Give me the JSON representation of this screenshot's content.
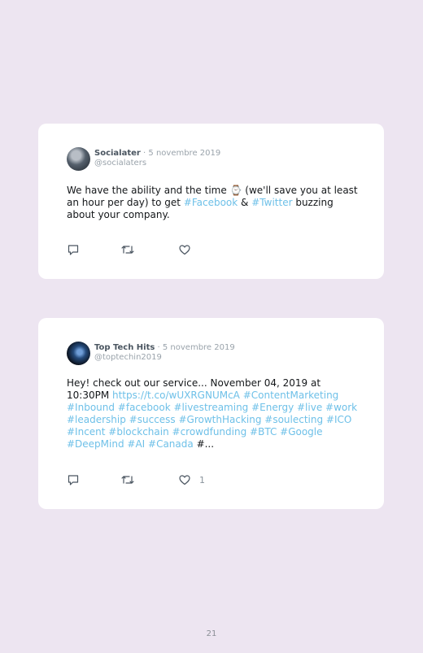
{
  "tweets": [
    {
      "name": "Socialater",
      "date": "· 5 novembre 2019",
      "handle": "@socialaters",
      "text_1": "We have the ability and the time ⌚ (we'll save you at least an hour per day) to get ",
      "link_1": "#Facebook",
      "text_2": " & ",
      "link_2": "#Twitter",
      "text_3": " buzzing about your company.",
      "likes": ""
    },
    {
      "name": "Top Tech Hits",
      "date": "· 5 novembre 2019",
      "handle": "@toptechin2019",
      "text_1": "Hey! check out our service... November 04, 2019 at 10:30PM ",
      "link_1": "https://t.co/wUXRGNUMcA #ContentMarketing #Inbound #facebook #livestreaming #Energy #live #work #leadership #success #GrowthHacking #soulecting #ICO #Incent #blockchain #crowdfunding #BTC #Google #DeepMind #AI #Canada",
      "text_2": " #...",
      "likes": "1"
    }
  ],
  "icons": {
    "reply": "reply-icon",
    "retweet": "retweet-icon",
    "like": "heart-icon",
    "color": "#4a5560"
  },
  "page_number": "21"
}
